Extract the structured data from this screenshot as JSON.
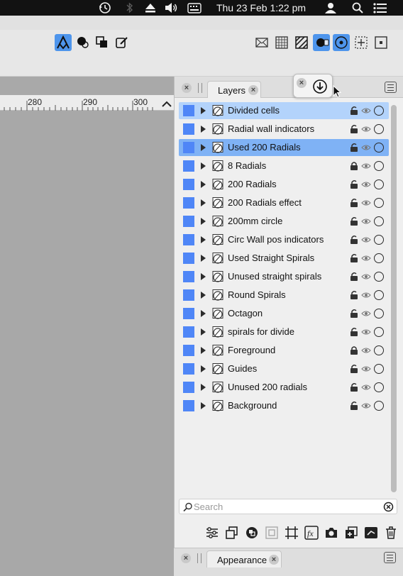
{
  "menubar": {
    "datetime": "Thu 23 Feb  1:22 pm"
  },
  "ruler": {
    "ticks": [
      "280",
      "290",
      "300"
    ]
  },
  "panel": {
    "tab_label": "Layers",
    "tab_close": "×",
    "search_placeholder": "Search",
    "layers": [
      {
        "name": "Divided cells",
        "state": "selected",
        "locked": false
      },
      {
        "name": "Radial wall indicators",
        "state": "",
        "locked": false
      },
      {
        "name": "Used 200 Radials",
        "state": "active",
        "locked": false
      },
      {
        "name": "8 Radials",
        "state": "",
        "locked": true
      },
      {
        "name": "200 Radials",
        "state": "",
        "locked": false
      },
      {
        "name": "200 Radials effect",
        "state": "",
        "locked": false
      },
      {
        "name": "200mm circle",
        "state": "",
        "locked": false
      },
      {
        "name": "Circ Wall pos indicators",
        "state": "",
        "locked": false
      },
      {
        "name": "Used Straight Spirals",
        "state": "",
        "locked": false
      },
      {
        "name": "Unused straight spirals",
        "state": "",
        "locked": false
      },
      {
        "name": "Round Spirals",
        "state": "",
        "locked": false
      },
      {
        "name": "Octagon",
        "state": "",
        "locked": false
      },
      {
        "name": "spirals for divide",
        "state": "",
        "locked": false
      },
      {
        "name": "Foreground",
        "state": "",
        "locked": true
      },
      {
        "name": "Guides",
        "state": "",
        "locked": false
      },
      {
        "name": "Unused 200 radials",
        "state": "",
        "locked": false
      },
      {
        "name": "Background",
        "state": "",
        "locked": false
      }
    ],
    "bottom_icons": [
      "adjustment-icon",
      "duplicate-icon",
      "group-icon",
      "layer-group-icon",
      "artboard-icon",
      "fx-icon",
      "snapshot-icon",
      "add-layer-icon",
      "add-pixel-layer-icon",
      "trash-icon"
    ]
  },
  "appearance": {
    "tab_label": "Appearance",
    "tab_close": "×"
  },
  "colors": {
    "accent": "#4e95ec",
    "layer_swatch": "#4f86f7",
    "row_selected": "#b3d3fb",
    "row_active": "#7fb2f5"
  }
}
